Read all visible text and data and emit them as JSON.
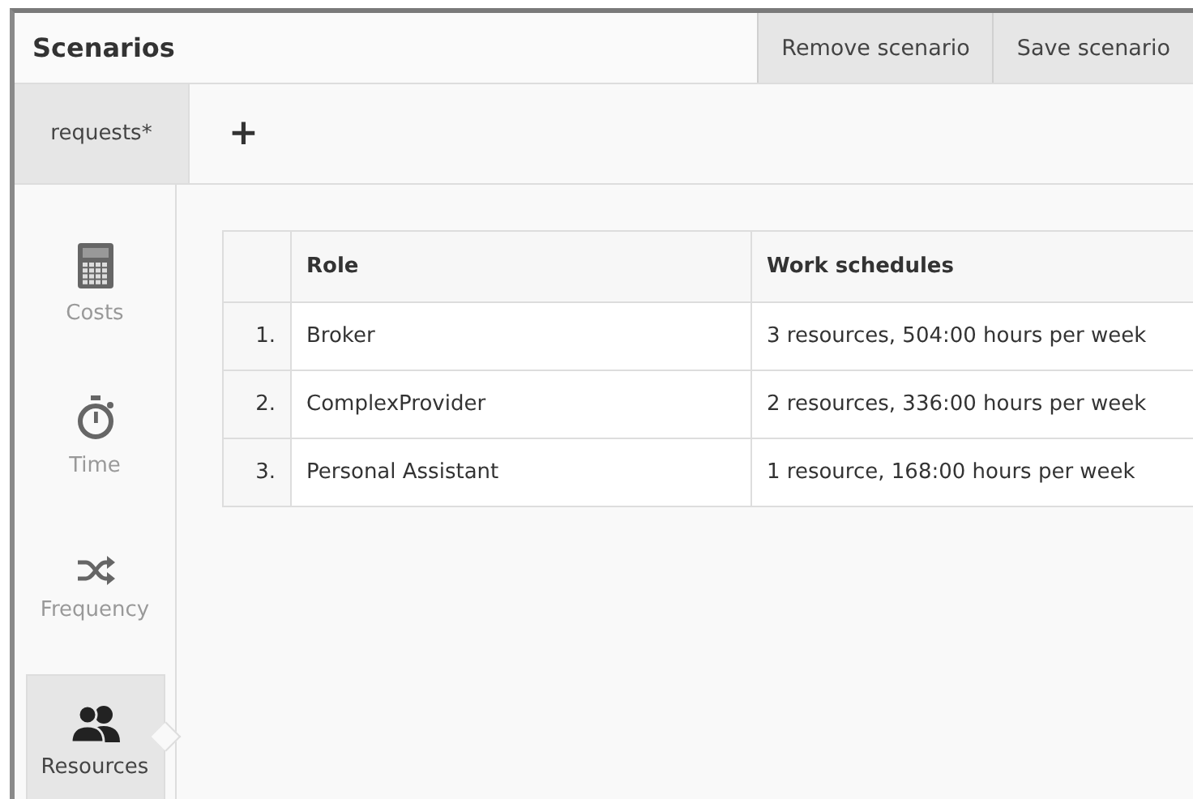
{
  "header": {
    "title": "Scenarios",
    "buttons": [
      "Remove scenario",
      "Save scenario"
    ]
  },
  "tabs": [
    {
      "label": "requests*",
      "selected": true
    }
  ],
  "add_tab": "+",
  "sidebar": {
    "items": [
      {
        "label": "Costs",
        "selected": false
      },
      {
        "label": "Time",
        "selected": false
      },
      {
        "label": "Frequency",
        "selected": false
      },
      {
        "label": "Resources",
        "selected": true
      }
    ]
  },
  "table": {
    "columns": [
      "Role",
      "Work schedules"
    ],
    "rows": [
      {
        "number": "1.",
        "role": "Broker",
        "schedules": "3 resources, 504:00 hours per week"
      },
      {
        "number": "2.",
        "role": "ComplexProvider",
        "schedules": "2 resources, 336:00 hours per week"
      },
      {
        "number": "3.",
        "role": "Personal Assistant",
        "schedules": "1 resource, 168:00 hours per week"
      }
    ]
  }
}
